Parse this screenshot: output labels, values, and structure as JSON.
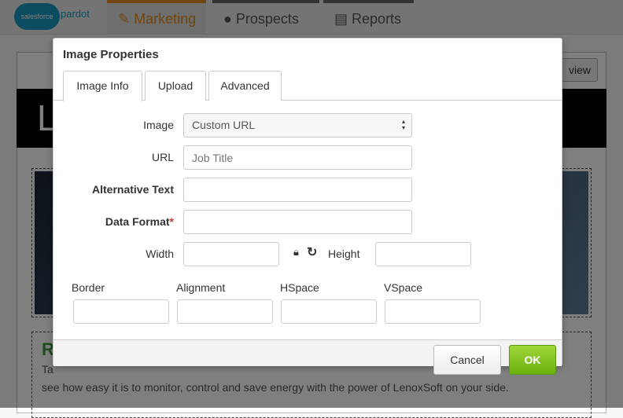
{
  "app": {
    "logo_text": "salesforce",
    "logo_word": "pardot",
    "nav": [
      {
        "label": "Marketing",
        "icon": "magic-wand-icon",
        "active": true
      },
      {
        "label": "Prospects",
        "icon": "users-icon"
      },
      {
        "label": "Reports",
        "icon": "bar-chart-icon"
      }
    ],
    "preview_label": "view",
    "banner_letter": "L",
    "heading_fragment": "R",
    "body_fragment": "Ta",
    "body_line": "see how easy it is to monitor, control and save energy with the power of LenoxSoft on your side."
  },
  "dialog": {
    "title": "Image Properties",
    "tabs": [
      "Image Info",
      "Upload",
      "Advanced"
    ],
    "active_tab": "Image Info",
    "fields": {
      "image": {
        "label": "Image",
        "value": "Custom URL"
      },
      "url": {
        "label": "URL",
        "placeholder": "Job Title"
      },
      "alt": {
        "label": "Alternative Text",
        "value": ""
      },
      "data_format": {
        "label": "Data Format",
        "required_mark": "*",
        "value": ""
      },
      "width": {
        "label": "Width",
        "value": ""
      },
      "height": {
        "label": "Height",
        "value": ""
      },
      "border": {
        "label": "Border",
        "value": ""
      },
      "alignment": {
        "label": "Alignment",
        "value": ""
      },
      "hspace": {
        "label": "HSpace",
        "value": ""
      },
      "vspace": {
        "label": "VSpace",
        "value": ""
      }
    },
    "cancel_label": "Cancel",
    "ok_label": "OK",
    "ok_color": "#7cbd1f"
  }
}
